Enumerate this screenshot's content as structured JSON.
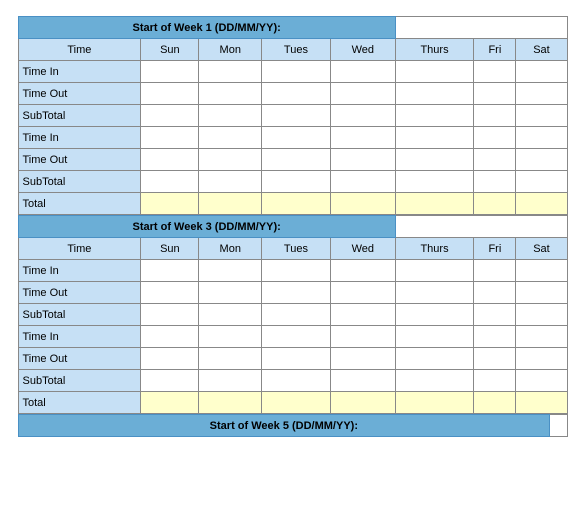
{
  "weeks": [
    {
      "header": "Start of Week 1 (DD/MM/YY):",
      "columns": [
        "Time",
        "Sun",
        "Mon",
        "Tues",
        "Wed",
        "Thurs",
        "Fri",
        "Sat"
      ],
      "rows": [
        {
          "label": "Time In",
          "cells": [
            "",
            "",
            "",
            "",
            "",
            "",
            "",
            ""
          ]
        },
        {
          "label": "Time Out",
          "cells": [
            "",
            "",
            "",
            "",
            "",
            "",
            "",
            ""
          ]
        },
        {
          "label": "SubTotal",
          "cells": [
            "",
            "",
            "",
            "",
            "",
            "",
            "",
            ""
          ]
        },
        {
          "label": "Time In",
          "cells": [
            "",
            "",
            "",
            "",
            "",
            "",
            "",
            ""
          ]
        },
        {
          "label": "Time Out",
          "cells": [
            "",
            "",
            "",
            "",
            "",
            "",
            "",
            ""
          ]
        },
        {
          "label": "SubTotal",
          "cells": [
            "",
            "",
            "",
            "",
            "",
            "",
            "",
            ""
          ]
        },
        {
          "label": "Total",
          "cells": [
            "",
            "",
            "",
            "",
            "",
            "",
            "",
            ""
          ]
        }
      ]
    },
    {
      "header": "Start of Week 3 (DD/MM/YY):",
      "columns": [
        "Time",
        "Sun",
        "Mon",
        "Tues",
        "Wed",
        "Thurs",
        "Fri",
        "Sat"
      ],
      "rows": [
        {
          "label": "Time In",
          "cells": [
            "",
            "",
            "",
            "",
            "",
            "",
            "",
            ""
          ]
        },
        {
          "label": "Time Out",
          "cells": [
            "",
            "",
            "",
            "",
            "",
            "",
            "",
            ""
          ]
        },
        {
          "label": "SubTotal",
          "cells": [
            "",
            "",
            "",
            "",
            "",
            "",
            "",
            ""
          ]
        },
        {
          "label": "Time In",
          "cells": [
            "",
            "",
            "",
            "",
            "",
            "",
            "",
            ""
          ]
        },
        {
          "label": "Time Out",
          "cells": [
            "",
            "",
            "",
            "",
            "",
            "",
            "",
            ""
          ]
        },
        {
          "label": "SubTotal",
          "cells": [
            "",
            "",
            "",
            "",
            "",
            "",
            "",
            ""
          ]
        },
        {
          "label": "Total",
          "cells": [
            "",
            "",
            "",
            "",
            "",
            "",
            "",
            ""
          ]
        }
      ]
    }
  ],
  "week5_header": "Start of Week 5 (DD/MM/YY):"
}
